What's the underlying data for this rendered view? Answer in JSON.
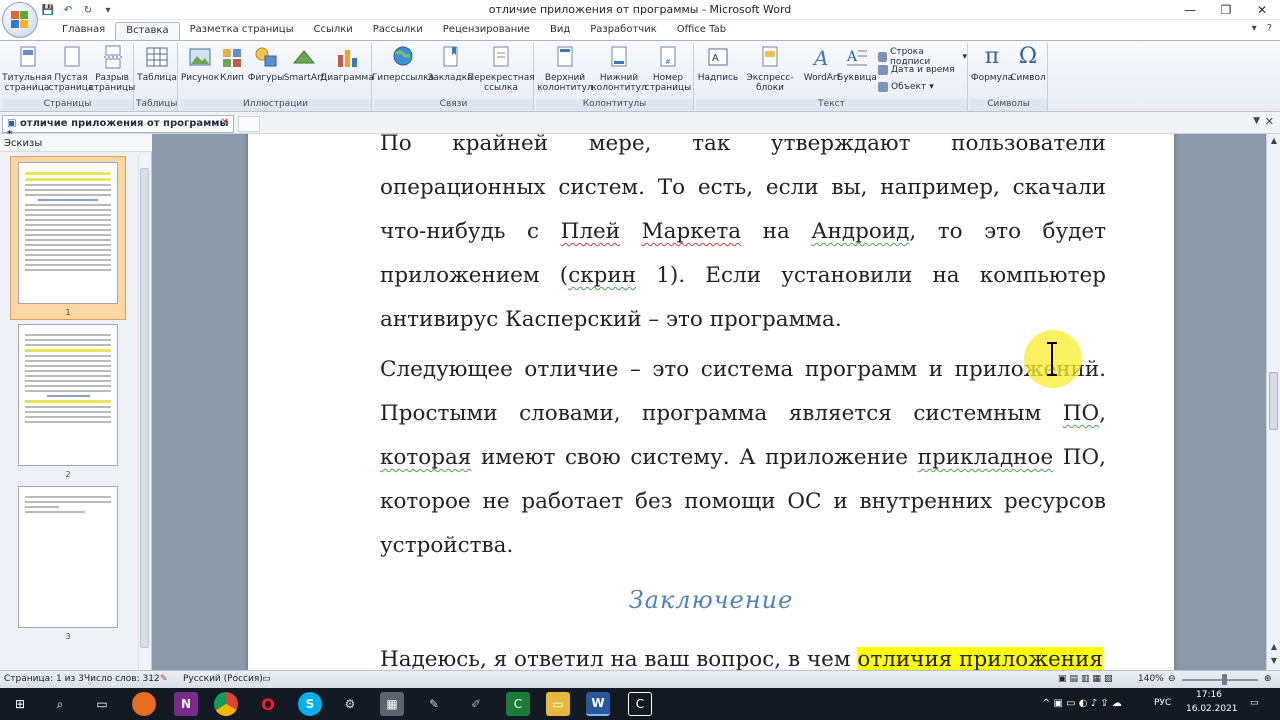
{
  "window": {
    "title": "отличие приложения от программы - Microsoft Word"
  },
  "tabs": [
    {
      "label": "Главная",
      "active": false
    },
    {
      "label": "Вставка",
      "active": true
    },
    {
      "label": "Разметка страницы",
      "active": false
    },
    {
      "label": "Ссылки",
      "active": false
    },
    {
      "label": "Рассылки",
      "active": false
    },
    {
      "label": "Рецензирование",
      "active": false
    },
    {
      "label": "Вид",
      "active": false
    },
    {
      "label": "Разработчик",
      "active": false
    },
    {
      "label": "Office Tab",
      "active": false
    }
  ],
  "ribbon": {
    "groups": {
      "pages": "Страницы",
      "tables": "Таблицы",
      "illustrations": "Иллюстрации",
      "links": "Связи",
      "headers": "Колонтитулы",
      "text": "Текст",
      "symbols": "Символы"
    },
    "buttons": {
      "cover_page": [
        "Титульная",
        "страница"
      ],
      "blank_page": [
        "Пустая",
        "страница"
      ],
      "page_break": [
        "Разрыв",
        "страницы"
      ],
      "table": "Таблица",
      "picture": "Рисунок",
      "clip": "Клип",
      "shapes": "Фигуры",
      "smartart": "SmartArt",
      "chart": "Диаграмма",
      "hyperlink": "Гиперссылка",
      "bookmark": "Закладка",
      "cross_ref": [
        "Перекрестная",
        "ссылка"
      ],
      "header": [
        "Верхний",
        "колонтитул"
      ],
      "footer": [
        "Нижний",
        "колонтитул"
      ],
      "page_number": [
        "Номер",
        "страницы"
      ],
      "textbox": "Надпись",
      "quickparts": "Экспресс-блоки",
      "wordart": "WordArt",
      "dropcap": "Буквица",
      "signature_line": "Строка подписи",
      "date_time": "Дата и время",
      "object": "Объект",
      "equation": "Формула",
      "symbol": "Символ"
    }
  },
  "doc_tab": {
    "label": "отличие приложения от программы *"
  },
  "thumbnails": {
    "header": "Эскизы",
    "pages": [
      "1",
      "2",
      "3"
    ]
  },
  "document": {
    "p1_lines": [
      "По крайней мере, так утверждают пользователи операционных",
      "систем. То есть, если вы, например, скачали что-нибудь с ",
      "Маркета",
      " на ",
      "Андроид",
      ", то это будет приложением (",
      "скрин",
      " 1). Если",
      "установили на компьютер антивирус Касперский – это",
      "программа."
    ],
    "p1_link_play": "Плей",
    "p2_parts": [
      "Следующее отличие – это система программ и приложений.",
      "Простыми словами, программа является системным ",
      "ПО",
      ",",
      "которая",
      " имеют свою систему. А приложение ",
      "прикладное",
      " ПО,",
      "которое не работает без помощи ОС и внутренних ресурсов",
      "устройства."
    ],
    "heading": "Заключение",
    "p3_plain": "Надеюсь, я ответил на ваш вопрос, в чем ",
    "p3_highlight": "отличия приложения"
  },
  "status": {
    "page": "Страница: 1 из 3",
    "words": "Число слов: 312",
    "language": "Русский (Россия)",
    "zoom": "140%"
  },
  "taskbar": {
    "lang": "РУС",
    "time": "17:16",
    "date": "16.02.2021"
  }
}
